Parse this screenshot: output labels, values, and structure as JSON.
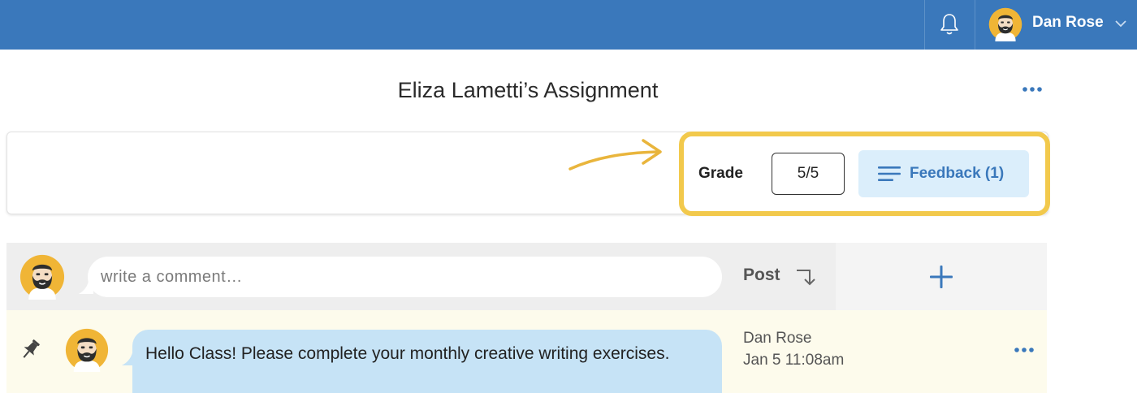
{
  "header": {
    "user_name": "Dan Rose",
    "icons": [
      "bell-icon",
      "avatar",
      "chevron-down-icon"
    ]
  },
  "page": {
    "title": "Eliza Lametti’s Assignment"
  },
  "grading": {
    "grade_label": "Grade",
    "grade_value": "5/5",
    "feedback_label": "Feedback (1)"
  },
  "comment_box": {
    "placeholder": "write a comment…",
    "post_label": "Post"
  },
  "messages": [
    {
      "text": "Hello Class! Please complete your monthly creative writing exercises.",
      "author": "Dan Rose",
      "time": "Jan 5 11:08am",
      "pinned": true
    }
  ],
  "colors": {
    "header_bg": "#3a78bb",
    "highlight": "#f2c94c",
    "feedback_bg": "#dbeefb",
    "bubble_bg": "#c6e3f6",
    "message_row_bg": "#fdfbec"
  }
}
